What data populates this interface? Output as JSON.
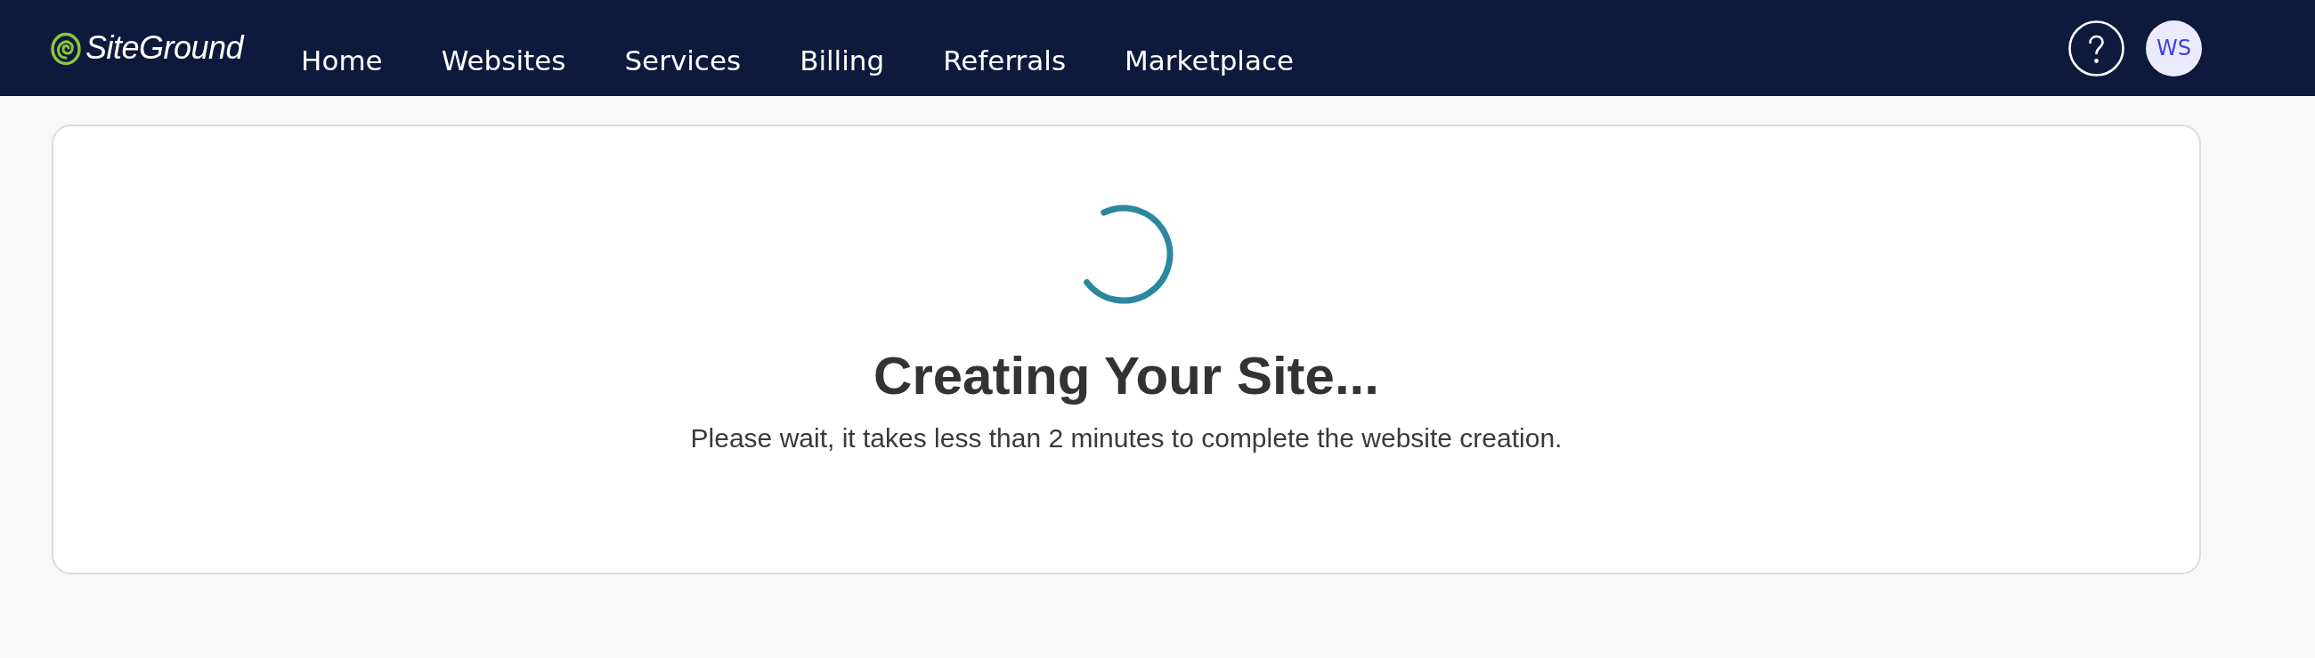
{
  "header": {
    "logo": {
      "text": "SiteGround"
    },
    "nav": [
      {
        "label": "Home"
      },
      {
        "label": "Websites"
      },
      {
        "label": "Services"
      },
      {
        "label": "Billing"
      },
      {
        "label": "Referrals"
      },
      {
        "label": "Marketplace"
      }
    ],
    "avatar": {
      "initials": "WS"
    }
  },
  "status_card": {
    "title": "Creating Your Site...",
    "message": "Please wait, it takes less than 2 minutes to complete the website creation."
  }
}
